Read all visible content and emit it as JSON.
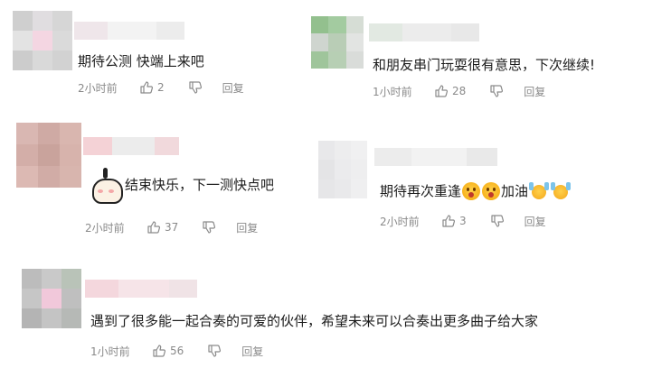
{
  "comments": [
    {
      "text": "期待公测 快端上来吧",
      "time": "2小时前",
      "likes": "2",
      "reply_label": "回复",
      "avatar_colors": [
        "#cfcfcf",
        "#e0dde0",
        "#d6d6d6",
        "#e3e3e3",
        "#f4d6e2",
        "#dadada",
        "#cccccc",
        "#d9d9d9",
        "#d2d2d2"
      ],
      "name_colors": [
        "#efe6ea",
        "#f3f3f3",
        "#ececec"
      ]
    },
    {
      "text": "和朋友串门玩耍很有意思，下次继续!",
      "time": "1小时前",
      "likes": "28",
      "reply_label": "回复",
      "avatar_colors": [
        "#93c08e",
        "#a3cba0",
        "#d6ddd5",
        "#cfd5cf",
        "#b9cdb6",
        "#e2e4e2",
        "#9fc59b",
        "#b7cfb4",
        "#d9dcd9"
      ],
      "name_colors": [
        "#e2e9e2",
        "#ececec",
        "#e8e8e8"
      ]
    },
    {
      "text": "结束快乐，下一测快点吧",
      "time": "2小时前",
      "likes": "37",
      "reply_label": "回复",
      "avatar_colors": [
        "#d9b7b2",
        "#cfaaa4",
        "#d9b6af",
        "#d3aea8",
        "#c9a39c",
        "#d7b3ac",
        "#dcb9b3",
        "#d1aca6",
        "#d8b5ae"
      ],
      "name_colors": [
        "#f4d2d6",
        "#ececec",
        "#f1d9dc"
      ]
    },
    {
      "text": "期待再次重逢",
      "text_after": "加油",
      "time": "2小时前",
      "likes": "3",
      "reply_label": "回复",
      "avatar_colors": [
        "#e8e8ea",
        "#ededee",
        "#f0f0f1",
        "#e4e4e6",
        "#ebebed",
        "#eeeeef",
        "#e6e6e8",
        "#e9e9eb",
        "#efeff0"
      ],
      "name_colors": [
        "#ececec",
        "#f2f2f2",
        "#e9e9e9"
      ]
    },
    {
      "text": "遇到了很多能一起合奏的可爱的伙伴，希望未来可以合奏出更多曲子给大家",
      "time": "1小时前",
      "likes": "56",
      "reply_label": "回复",
      "avatar_colors": [
        "#bcbcbc",
        "#c9c9c9",
        "#b9c3b8",
        "#c6c6c6",
        "#f1c8da",
        "#bfbfbf",
        "#b4b4b4",
        "#c4c4c4",
        "#b6b9b6"
      ],
      "name_colors": [
        "#f4d7dd",
        "#f6e4e8",
        "#f0e3e6"
      ]
    }
  ]
}
